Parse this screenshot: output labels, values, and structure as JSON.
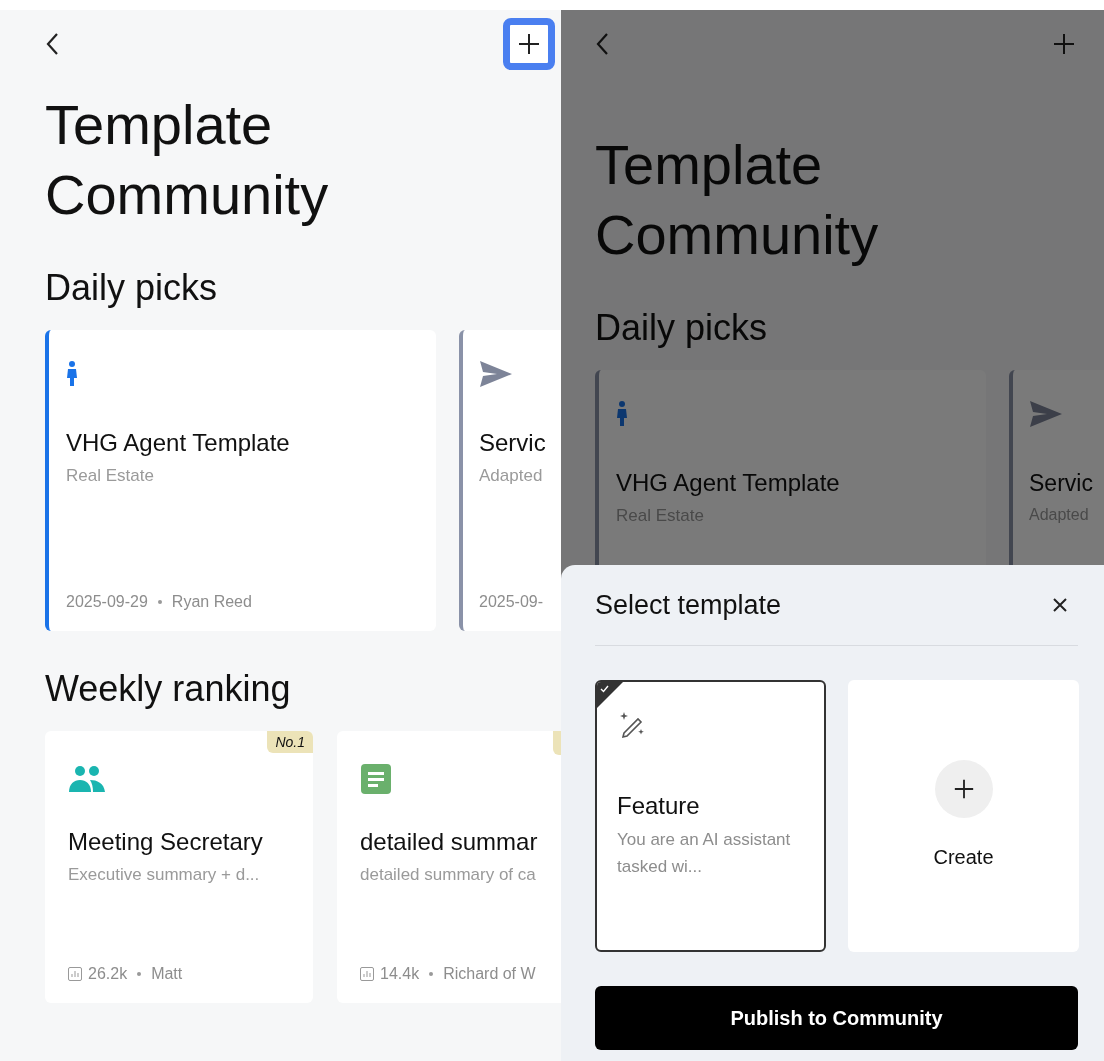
{
  "screens": [
    {
      "header": {
        "add": {
          "highlighted": true
        }
      },
      "title": "Template\nCommunity",
      "sections": [
        {
          "kind": "picks",
          "title": "Daily picks",
          "cards": [
            {
              "kind": "person",
              "color": "#1a73e8",
              "title": "VHG Agent Template",
              "subtitle": "Real Estate",
              "date": "2025-09-29",
              "author": "Ryan Reed"
            },
            {
              "kind": "send",
              "color": "#8a92a8",
              "title": "Servic",
              "subtitle": "Adapted",
              "date": "2025-09-"
            }
          ]
        },
        {
          "kind": "ranking",
          "title": "Weekly ranking",
          "cards": [
            {
              "kind": "people",
              "ranked": true,
              "badge_text": "No.1",
              "title": "Meeting Secretary",
              "subtitle": "Executive summary + d...",
              "views": "26.2k",
              "author": "Matt"
            },
            {
              "kind": "document",
              "ranked": true,
              "title": "detailed summar",
              "subtitle": "detailed summary of ca",
              "views": "14.4k",
              "author": "Richard of W"
            }
          ]
        }
      ]
    },
    {
      "header": {
        "add": {
          "highlighted": false
        }
      },
      "title": "Template\nCommunity",
      "sections": [
        {
          "kind": "picks",
          "title": "Daily picks",
          "cards": [
            {
              "kind": "person",
              "title": "VHG Agent Template",
              "subtitle": "Real Estate"
            },
            {
              "kind": "send",
              "title": "Servic",
              "subtitle": "Adapted"
            }
          ]
        }
      ],
      "sheet": {
        "title": "Select template",
        "options": [
          {
            "kind": "template",
            "selected": true,
            "title": "Feature",
            "description": "You are an AI assistant tasked wi..."
          },
          {
            "kind": "create",
            "selected": false,
            "label": "Create"
          }
        ],
        "button": "Publish to Community"
      }
    }
  ]
}
